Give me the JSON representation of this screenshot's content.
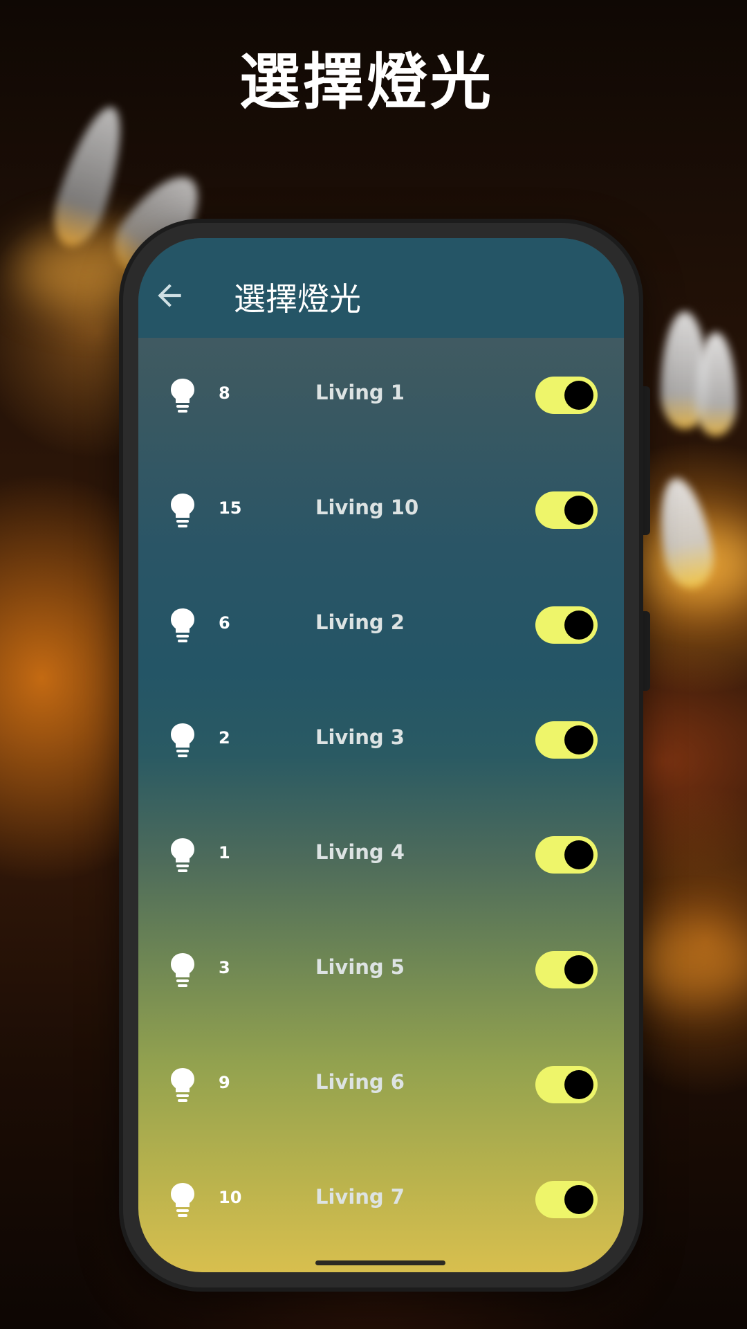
{
  "headline": "選擇燈光",
  "app": {
    "title": "選擇燈光",
    "back_icon": "arrow-left-icon"
  },
  "lights": [
    {
      "id": "8",
      "name": "Living 1",
      "on": true
    },
    {
      "id": "15",
      "name": "Living 10",
      "on": true
    },
    {
      "id": "6",
      "name": "Living 2",
      "on": true
    },
    {
      "id": "2",
      "name": "Living 3",
      "on": true
    },
    {
      "id": "1",
      "name": "Living 4",
      "on": true
    },
    {
      "id": "3",
      "name": "Living 5",
      "on": true
    },
    {
      "id": "9",
      "name": "Living 6",
      "on": true
    },
    {
      "id": "10",
      "name": "Living 7",
      "on": true
    }
  ],
  "colors": {
    "appbar": "#255566",
    "toggle_track": "#eef56a",
    "toggle_knob": "#000000"
  }
}
